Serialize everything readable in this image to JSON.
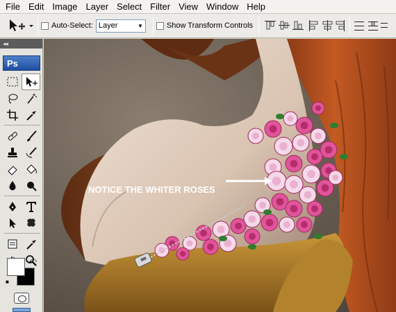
{
  "menu": [
    "File",
    "Edit",
    "Image",
    "Layer",
    "Select",
    "Filter",
    "View",
    "Window",
    "Help"
  ],
  "options": {
    "auto_select_label": "Auto-Select:",
    "auto_select_checked": false,
    "layer_select_value": "Layer",
    "transform_label": "Show Transform Controls",
    "transform_checked": false
  },
  "toolbox": {
    "logo": "Ps",
    "collapse_glyph": "◂◂"
  },
  "canvas": {
    "annotation": "NOTICE THE WHITER ROSES"
  },
  "colors": {
    "foreground": "#ffffff",
    "background": "#000000",
    "rose_pink": "#e0559a",
    "rose_white": "#f6d9ea",
    "hair": "#b8511f"
  }
}
